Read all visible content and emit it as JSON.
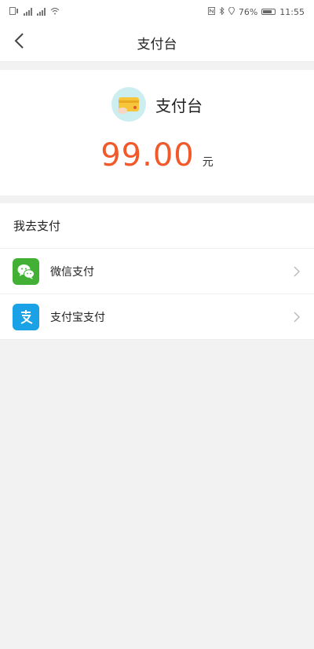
{
  "status_bar": {
    "battery": "76%",
    "time": "11:55"
  },
  "navbar": {
    "title": "支付台"
  },
  "summary": {
    "merchant_name": "支付台",
    "amount": "99.00",
    "unit": "元"
  },
  "payment": {
    "section_title": "我去支付",
    "methods": [
      {
        "label": "微信支付",
        "icon": "wechat-icon"
      },
      {
        "label": "支付宝支付",
        "icon": "alipay-icon"
      }
    ]
  },
  "colors": {
    "amount": "#f1592a",
    "wechat": "#41b035",
    "alipay": "#1aa1e6",
    "background": "#f2f2f2"
  }
}
